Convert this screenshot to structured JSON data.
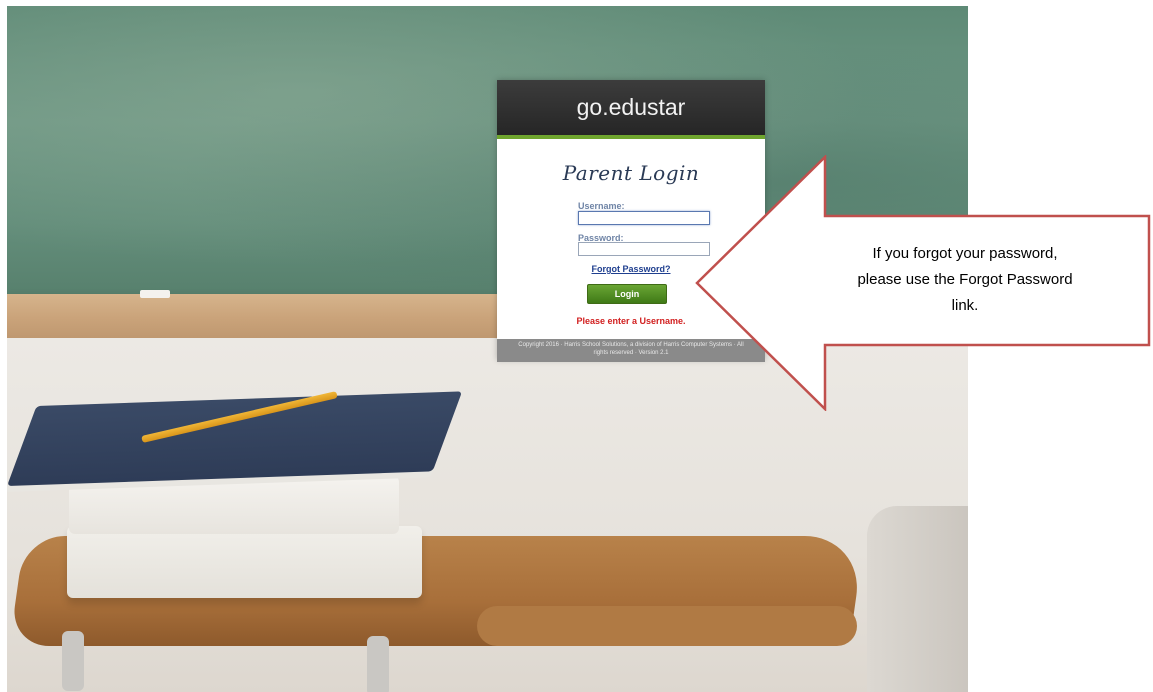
{
  "login": {
    "brand": "go.edustar",
    "title": "Parent Login",
    "username_label": "Username:",
    "username_value": "",
    "password_label": "Password:",
    "password_value": "",
    "forgot_link": "Forgot Password?",
    "login_button": "Login",
    "error_message": "Please enter a Username.",
    "footer_line1": "Copyright 2016 · Harris School Solutions, a division of Harris Computer Systems · All",
    "footer_line2": "rights reserved · Version 2.1"
  },
  "callout": {
    "text_line1": "If you forgot your password,",
    "text_line2": "please use the Forgot Password",
    "text_line3": "link."
  },
  "colors": {
    "header_bg": "#2b2b2b",
    "header_accent": "#6fa52e",
    "button_green": "#4d8a1f",
    "error_red": "#d22020",
    "link_blue": "#1f3f8f",
    "callout_border": "#c0504d",
    "footer_bg": "#8a8a8a"
  }
}
